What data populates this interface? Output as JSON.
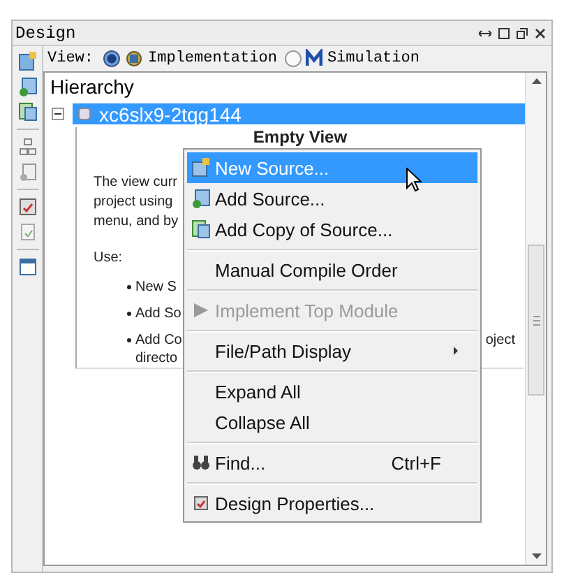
{
  "window": {
    "title": "Design"
  },
  "view": {
    "label": "View:",
    "options": [
      {
        "label": "Implementation",
        "selected": true,
        "kind": "implementation"
      },
      {
        "label": "Simulation",
        "selected": false,
        "kind": "simulation"
      }
    ]
  },
  "hierarchy": {
    "title": "Hierarchy",
    "tree": [
      {
        "label": "xc6slx9-2tqg144",
        "expanded": true,
        "selected": true
      }
    ]
  },
  "empty_view": {
    "title": "Empty View",
    "lines": [
      "The view curr",
      "project using",
      "menu, and by"
    ],
    "use_label": "Use:",
    "bullets": [
      {
        "text": "New S"
      },
      {
        "text": "Add So"
      },
      {
        "text": "Add Co",
        "continuation": "directo",
        "trailing": "oject"
      }
    ]
  },
  "context_menu": {
    "groups": [
      [
        {
          "label": "New Source...",
          "kind": "new",
          "selected": true,
          "disabled": false,
          "submenu": false
        },
        {
          "label": "Add Source...",
          "kind": "add",
          "selected": false,
          "disabled": false,
          "submenu": false
        },
        {
          "label": "Add Copy of Source...",
          "kind": "copy",
          "selected": false,
          "disabled": false,
          "submenu": false
        }
      ],
      [
        {
          "label": "Manual Compile Order",
          "kind": "plain",
          "selected": false,
          "disabled": false,
          "submenu": false
        }
      ],
      [
        {
          "label": "Implement Top Module",
          "kind": "run",
          "selected": false,
          "disabled": true,
          "submenu": false
        }
      ],
      [
        {
          "label": "File/Path Display",
          "kind": "plain",
          "selected": false,
          "disabled": false,
          "submenu": true
        }
      ],
      [
        {
          "label": "Expand All",
          "kind": "plain",
          "selected": false,
          "disabled": false,
          "submenu": false
        },
        {
          "label": "Collapse All",
          "kind": "plain",
          "selected": false,
          "disabled": false,
          "submenu": false
        }
      ],
      [
        {
          "label": "Find...",
          "kind": "find",
          "shortcut": "Ctrl+F",
          "selected": false,
          "disabled": false,
          "submenu": false
        }
      ],
      [
        {
          "label": "Design Properties...",
          "kind": "properties",
          "selected": false,
          "disabled": false,
          "submenu": false
        }
      ]
    ]
  }
}
